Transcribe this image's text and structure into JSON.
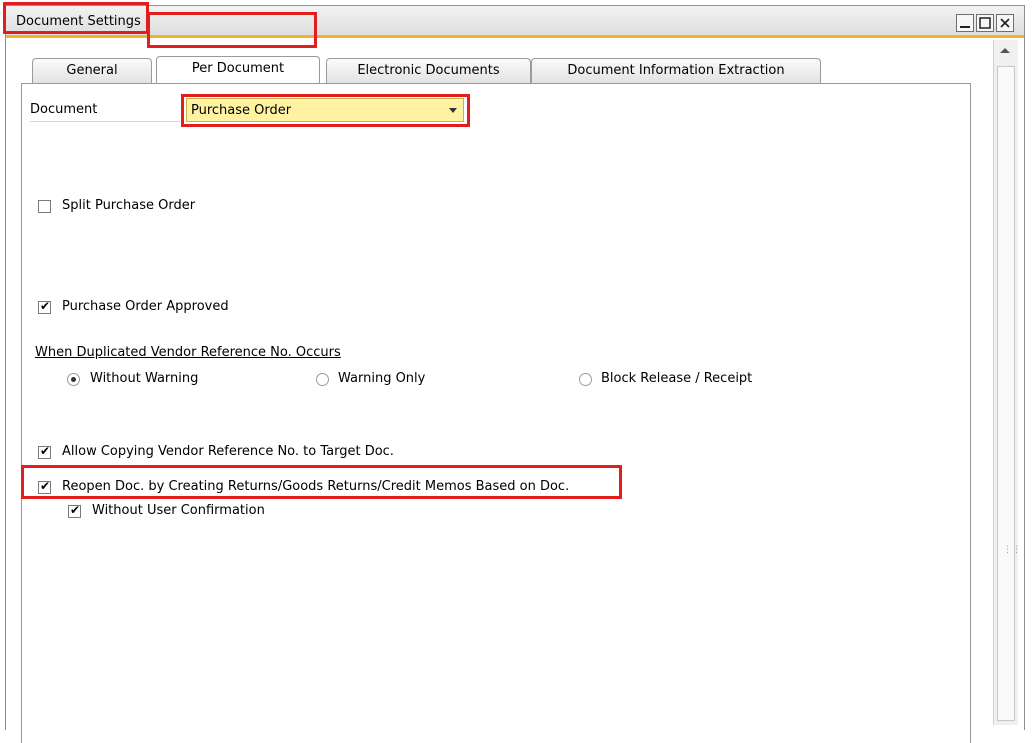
{
  "window": {
    "title": "Document Settings",
    "controls": [
      "minimize-icon",
      "maximize-icon",
      "close-icon"
    ]
  },
  "tabs": [
    {
      "label": "General",
      "active": false
    },
    {
      "label": "Per Document",
      "active": true
    },
    {
      "label": "Electronic Documents",
      "active": false
    },
    {
      "label": "Document Information Extraction",
      "active": false
    }
  ],
  "document": {
    "label": "Document",
    "selected": "Purchase Order"
  },
  "options": {
    "split": {
      "label": "Split Purchase Order",
      "checked": false
    },
    "approved": {
      "label": "Purchase Order Approved",
      "checked": true
    },
    "duplicated_header": "When Duplicated Vendor Reference No. Occurs",
    "radios": [
      {
        "label": "Without Warning",
        "selected": true
      },
      {
        "label": "Warning Only",
        "selected": false
      },
      {
        "label": "Block Release / Receipt",
        "selected": false
      }
    ],
    "allow_copy": {
      "label": "Allow Copying Vendor Reference No. to Target Doc.",
      "checked": true
    },
    "reopen": {
      "label": "Reopen Doc. by Creating Returns/Goods Returns/Credit Memos Based on Doc.",
      "checked": true
    },
    "without_confirm": {
      "label": "Without User Confirmation",
      "checked": true
    }
  },
  "colors": {
    "highlight": "#e11d1d",
    "title_accent": "#f0b429",
    "combo_bg": "#fff3a3"
  }
}
